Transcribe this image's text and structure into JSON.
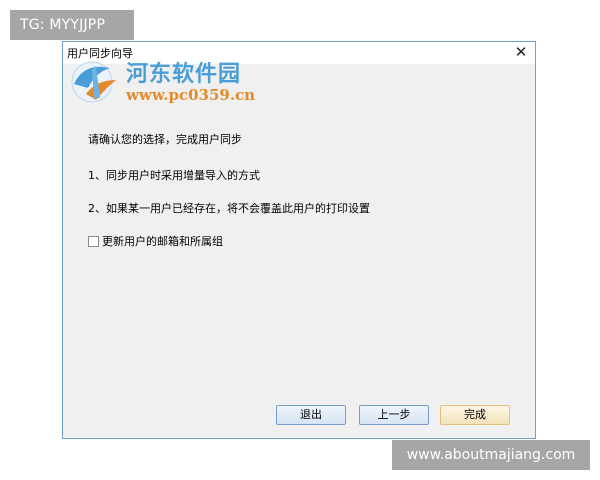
{
  "overlay": {
    "tag_text": "TG: MYYJJPP",
    "site_text": "www.aboutmajiang.com"
  },
  "dialog": {
    "title": "用户同步向导",
    "close_glyph": "✕",
    "lines": {
      "confirm": "请确认您的选择，完成用户同步",
      "step1": "1、同步用户时采用增量导入的方式",
      "step2": "2、如果某一用户已经存在，将不会覆盖此用户的打印设置"
    },
    "checkbox": {
      "label": "更新用户的邮箱和所属组",
      "checked": false
    },
    "buttons": {
      "exit": "退出",
      "prev": "上一步",
      "finish": "完成"
    }
  },
  "watermark": {
    "name": "河东软件园",
    "url": "www.pc0359.cn",
    "colors": {
      "name": "#4a9ed8",
      "url": "#e58a2a"
    }
  },
  "colors": {
    "dialog_border": "#6f9fd1",
    "dialog_bg": "#f0f0f0",
    "badge_bg": "#a6a6a6"
  }
}
